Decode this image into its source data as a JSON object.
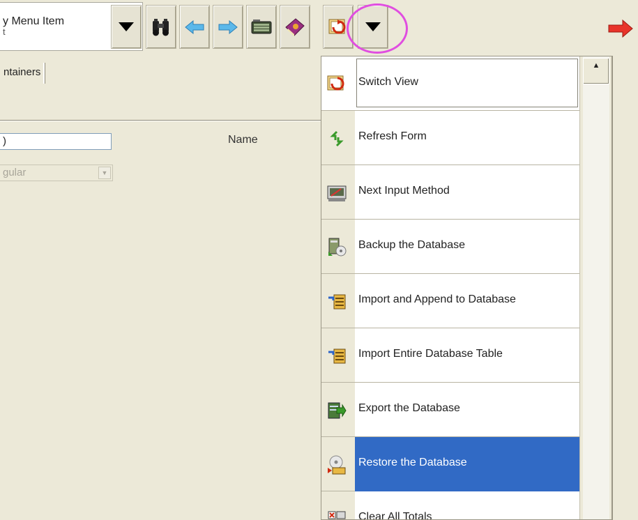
{
  "toolbar": {
    "menu_item_field": "y Menu Item",
    "menu_item_field_line2": "t",
    "buttons": [
      {
        "icon": "chevron-down-icon"
      },
      {
        "icon": "binoculars-icon"
      },
      {
        "icon": "arrow-left-icon"
      },
      {
        "icon": "arrow-right-icon"
      },
      {
        "icon": "keyboard-icon"
      },
      {
        "icon": "book-icon"
      },
      {
        "icon": "switch-view-icon"
      },
      {
        "icon": "chevron-down-icon"
      }
    ],
    "exit_icon": "red-arrow-right-icon"
  },
  "form": {
    "tab_label": "ntainers",
    "id_value": ")",
    "name_label": "Name",
    "type_value": "gular"
  },
  "dropdown": {
    "items": [
      {
        "label": "Switch View",
        "icon": "switch-view-icon",
        "state": "focused"
      },
      {
        "label": "Refresh Form",
        "icon": "refresh-icon"
      },
      {
        "label": "Next Input Method",
        "icon": "input-method-icon"
      },
      {
        "label": "Backup the Database",
        "icon": "backup-icon"
      },
      {
        "label": "Import and Append to Database",
        "icon": "import-append-icon"
      },
      {
        "label": "Import Entire Database Table",
        "icon": "import-table-icon"
      },
      {
        "label": "Export the Database",
        "icon": "export-icon"
      },
      {
        "label": "Restore the Database",
        "icon": "restore-icon",
        "state": "highlighted"
      },
      {
        "label": "Clear All Totals",
        "icon": "clear-totals-icon"
      }
    ]
  },
  "colors": {
    "highlight": "#316ac5",
    "annotation_circle": "#e04ee0",
    "window_bg": "#ece9d8"
  }
}
